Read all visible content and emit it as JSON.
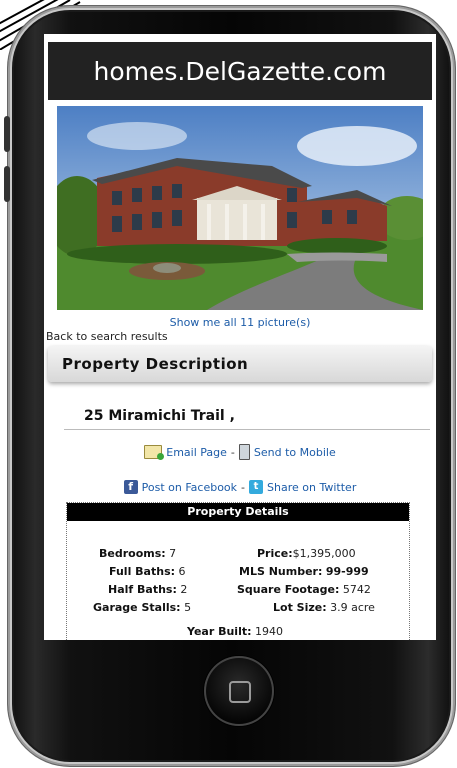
{
  "header": {
    "site_title": "homes.DelGazette.com"
  },
  "photo": {
    "show_all_label": "Show me all 11 picture(s)"
  },
  "nav": {
    "back_label": "Back to search results"
  },
  "description": {
    "heading": "Property Description",
    "address": "25 Miramichi Trail ,"
  },
  "share": {
    "email_label": "Email Page",
    "mobile_label": "Send to Mobile",
    "facebook_label": "Post on Facebook",
    "twitter_label": "Share on Twitter",
    "separator": "-"
  },
  "details": {
    "heading": "Property Details",
    "bedrooms": {
      "label": "Bedrooms:",
      "value": "7"
    },
    "full_baths": {
      "label": "Full Baths:",
      "value": "6"
    },
    "half_baths": {
      "label": "Half Baths:",
      "value": "2"
    },
    "garage_stalls": {
      "label": "Garage Stalls:",
      "value": "5"
    },
    "price": {
      "label": "Price:",
      "value": "$1,395,000"
    },
    "mls_number": {
      "label": "MLS Number:",
      "value": "99-999"
    },
    "square_footage": {
      "label": "Square Footage:",
      "value": "5742"
    },
    "lot_size": {
      "label": "Lot Size:",
      "value": "3.9 acre"
    },
    "year_built": {
      "label": "Year Built:",
      "value": "1940"
    }
  },
  "colors": {
    "link": "#1d5ca8",
    "header_bg": "#222222",
    "details_head_bg": "#000000"
  },
  "icons": [
    "email-icon",
    "mobile-icon",
    "facebook-icon",
    "twitter-icon",
    "home-button-icon"
  ]
}
